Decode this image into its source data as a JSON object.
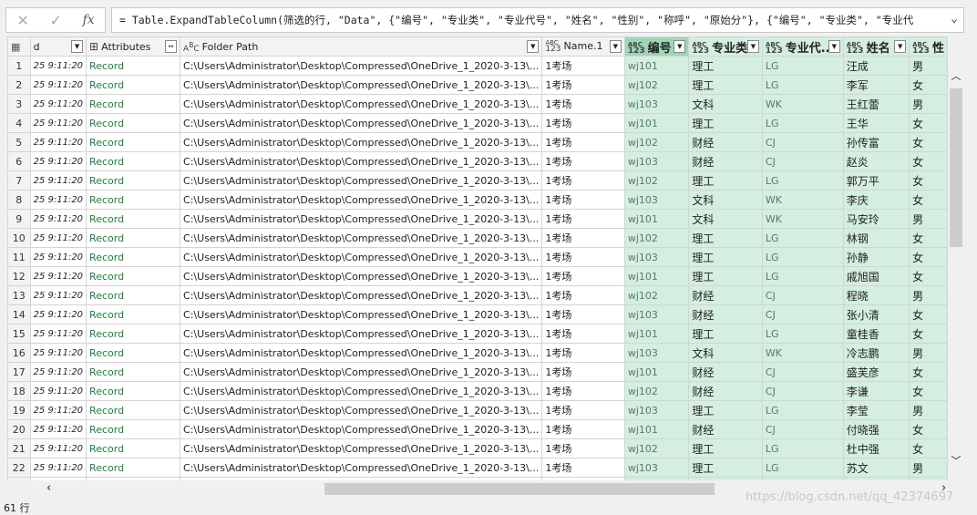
{
  "formula_bar": {
    "cancel_icon": "x-icon",
    "confirm_icon": "check-icon",
    "fx_label": "fx",
    "formula": "= Table.ExpandTableColumn(筛选的行, \"Data\", {\"编号\", \"专业类\", \"专业代号\", \"姓名\", \"性别\", \"称呼\", \"原始分\"}, {\"编号\", \"专业类\", \"专业代"
  },
  "columns": [
    {
      "label": "d",
      "type": ""
    },
    {
      "label": "Attributes",
      "type": "table"
    },
    {
      "label": "Folder Path",
      "type": "ABC"
    },
    {
      "label": "Name.1",
      "type": "ABC123"
    },
    {
      "label": "编号",
      "type": "ABC123"
    },
    {
      "label": "专业类",
      "type": "ABC123"
    },
    {
      "label": "专业代...",
      "type": "ABC123"
    },
    {
      "label": "姓名",
      "type": "ABC123"
    },
    {
      "label": "性",
      "type": "ABC123"
    }
  ],
  "type_label": {
    "abc": "ABC",
    "num": "123"
  },
  "rows": [
    [
      "25 9:11:20",
      "Record",
      "C:\\Users\\Administrator\\Desktop\\Compressed\\OneDrive_1_2020-3-13\\...",
      "1考场",
      "wj101",
      "理工",
      "LG",
      "汪成",
      "男"
    ],
    [
      "25 9:11:20",
      "Record",
      "C:\\Users\\Administrator\\Desktop\\Compressed\\OneDrive_1_2020-3-13\\...",
      "1考场",
      "wj102",
      "理工",
      "LG",
      "李军",
      "女"
    ],
    [
      "25 9:11:20",
      "Record",
      "C:\\Users\\Administrator\\Desktop\\Compressed\\OneDrive_1_2020-3-13\\...",
      "1考场",
      "wj103",
      "文科",
      "WK",
      "王红蕾",
      "男"
    ],
    [
      "25 9:11:20",
      "Record",
      "C:\\Users\\Administrator\\Desktop\\Compressed\\OneDrive_1_2020-3-13\\...",
      "1考场",
      "wj101",
      "理工",
      "LG",
      "王华",
      "女"
    ],
    [
      "25 9:11:20",
      "Record",
      "C:\\Users\\Administrator\\Desktop\\Compressed\\OneDrive_1_2020-3-13\\...",
      "1考场",
      "wj102",
      "财经",
      "CJ",
      "孙传富",
      "女"
    ],
    [
      "25 9:11:20",
      "Record",
      "C:\\Users\\Administrator\\Desktop\\Compressed\\OneDrive_1_2020-3-13\\...",
      "1考场",
      "wj103",
      "财经",
      "CJ",
      "赵炎",
      "女"
    ],
    [
      "25 9:11:20",
      "Record",
      "C:\\Users\\Administrator\\Desktop\\Compressed\\OneDrive_1_2020-3-13\\...",
      "1考场",
      "wj102",
      "理工",
      "LG",
      "郭万平",
      "女"
    ],
    [
      "25 9:11:20",
      "Record",
      "C:\\Users\\Administrator\\Desktop\\Compressed\\OneDrive_1_2020-3-13\\...",
      "1考场",
      "wj103",
      "文科",
      "WK",
      "李庆",
      "女"
    ],
    [
      "25 9:11:20",
      "Record",
      "C:\\Users\\Administrator\\Desktop\\Compressed\\OneDrive_1_2020-3-13\\...",
      "1考场",
      "wj101",
      "文科",
      "WK",
      "马安玲",
      "男"
    ],
    [
      "25 9:11:20",
      "Record",
      "C:\\Users\\Administrator\\Desktop\\Compressed\\OneDrive_1_2020-3-13\\...",
      "1考场",
      "wj102",
      "理工",
      "LG",
      "林钢",
      "女"
    ],
    [
      "25 9:11:20",
      "Record",
      "C:\\Users\\Administrator\\Desktop\\Compressed\\OneDrive_1_2020-3-13\\...",
      "1考场",
      "wj103",
      "理工",
      "LG",
      "孙静",
      "女"
    ],
    [
      "25 9:11:20",
      "Record",
      "C:\\Users\\Administrator\\Desktop\\Compressed\\OneDrive_1_2020-3-13\\...",
      "1考场",
      "wj101",
      "理工",
      "LG",
      "戚旭国",
      "女"
    ],
    [
      "25 9:11:20",
      "Record",
      "C:\\Users\\Administrator\\Desktop\\Compressed\\OneDrive_1_2020-3-13\\...",
      "1考场",
      "wj102",
      "财经",
      "CJ",
      "程晓",
      "男"
    ],
    [
      "25 9:11:20",
      "Record",
      "C:\\Users\\Administrator\\Desktop\\Compressed\\OneDrive_1_2020-3-13\\...",
      "1考场",
      "wj103",
      "财经",
      "CJ",
      "张小清",
      "女"
    ],
    [
      "25 9:11:20",
      "Record",
      "C:\\Users\\Administrator\\Desktop\\Compressed\\OneDrive_1_2020-3-13\\...",
      "1考场",
      "wj101",
      "理工",
      "LG",
      "童桂香",
      "女"
    ],
    [
      "25 9:11:20",
      "Record",
      "C:\\Users\\Administrator\\Desktop\\Compressed\\OneDrive_1_2020-3-13\\...",
      "1考场",
      "wj103",
      "文科",
      "WK",
      "冷志鹏",
      "男"
    ],
    [
      "25 9:11:20",
      "Record",
      "C:\\Users\\Administrator\\Desktop\\Compressed\\OneDrive_1_2020-3-13\\...",
      "1考场",
      "wj101",
      "财经",
      "CJ",
      "盛芙彦",
      "女"
    ],
    [
      "25 9:11:20",
      "Record",
      "C:\\Users\\Administrator\\Desktop\\Compressed\\OneDrive_1_2020-3-13\\...",
      "1考场",
      "wj102",
      "财经",
      "CJ",
      "李谦",
      "女"
    ],
    [
      "25 9:11:20",
      "Record",
      "C:\\Users\\Administrator\\Desktop\\Compressed\\OneDrive_1_2020-3-13\\...",
      "1考场",
      "wj103",
      "理工",
      "LG",
      "李莹",
      "男"
    ],
    [
      "25 9:11:20",
      "Record",
      "C:\\Users\\Administrator\\Desktop\\Compressed\\OneDrive_1_2020-3-13\\...",
      "1考场",
      "wj101",
      "财经",
      "CJ",
      "付晓强",
      "女"
    ],
    [
      "25 9:11:20",
      "Record",
      "C:\\Users\\Administrator\\Desktop\\Compressed\\OneDrive_1_2020-3-13\\...",
      "1考场",
      "wj102",
      "理工",
      "LG",
      "杜中强",
      "女"
    ],
    [
      "25 9:11:20",
      "Record",
      "C:\\Users\\Administrator\\Desktop\\Compressed\\OneDrive_1_2020-3-13\\...",
      "1考场",
      "wj103",
      "理工",
      "LG",
      "苏文",
      "男"
    ],
    [
      "",
      "",
      "",
      "",
      "",
      "",
      "",
      "",
      ""
    ]
  ],
  "status": {
    "row_count": "61 行"
  },
  "watermark": "https://blog.csdn.net/qq_42374697",
  "colors": {
    "selected_header": "#9fd6b5",
    "expanded_column_bg": "#d4eee0",
    "record_link": "#1a7f3c"
  }
}
